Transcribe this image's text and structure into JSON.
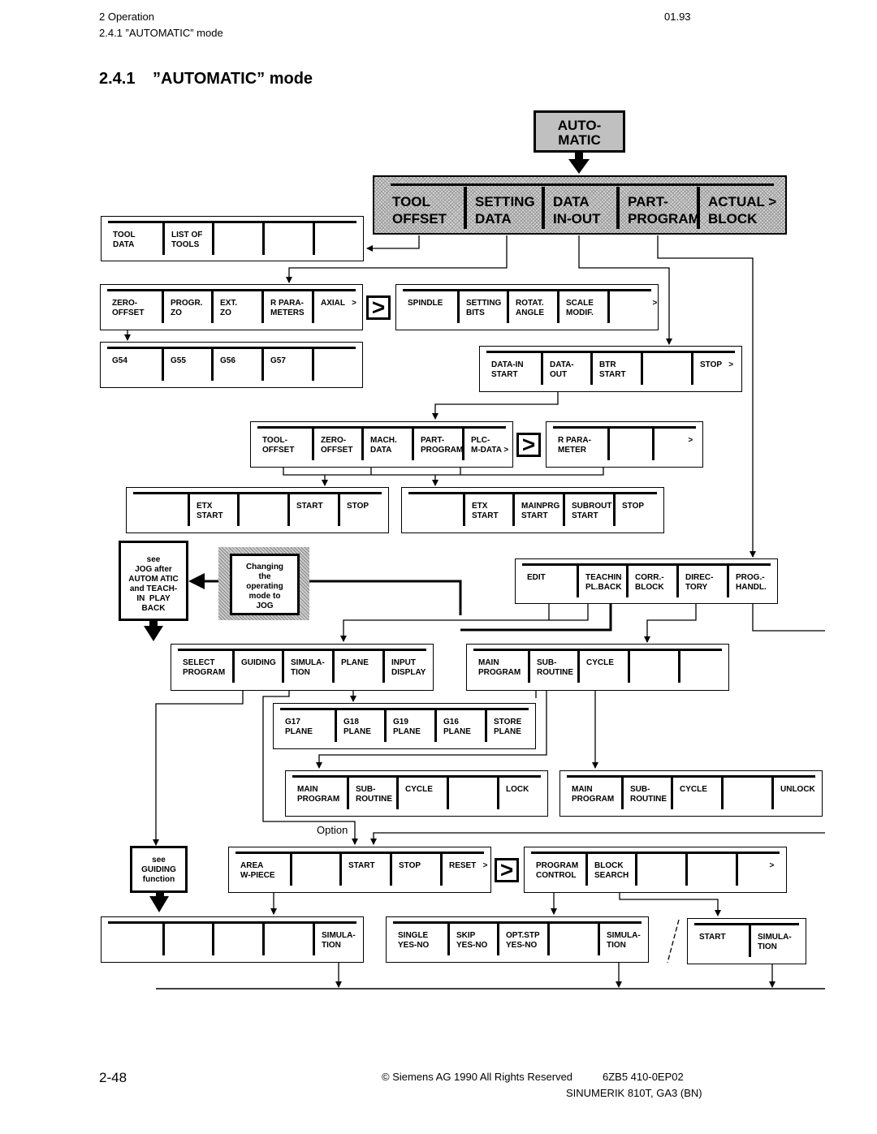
{
  "header": {
    "chapter": "2  Operation",
    "section": "2.4.1  ”AUTOMATIC” mode",
    "date": "01.93"
  },
  "title": {
    "number": "2.4.1",
    "text": "”AUTOMATIC” mode"
  },
  "mode_key": "AUTO-\nMATIC",
  "main_bar": [
    "TOOL\nOFFSET",
    "SETTING\nDATA",
    "DATA\nIN-OUT",
    "PART-\nPROGRAM",
    "ACTUAL >\nBLOCK"
  ],
  "bars": {
    "tool_offset": [
      "TOOL\nDATA",
      "LIST OF\nTOOLS",
      "",
      "",
      ""
    ],
    "setting_data_1": [
      "ZERO-\nOFFSET",
      "PROGR.\nZO",
      "EXT.\nZO",
      "R PARA-\nMETERS",
      "AXIAL   >"
    ],
    "setting_data_2": [
      "SPINDLE",
      "SETTING\nBITS",
      "ROTAT.\nANGLE",
      "SCALE\nMODIF.",
      "                >"
    ],
    "zero_offset": [
      "G54",
      "G55",
      "G56",
      "G57",
      ""
    ],
    "data_in_out": [
      "DATA-IN\nSTART",
      "DATA-\nOUT",
      "BTR\nSTART",
      "",
      "STOP   >"
    ],
    "data_out_1": [
      "TOOL-\nOFFSET",
      "ZERO-\nOFFSET",
      "MACH.\nDATA",
      "PART-\nPROGRAM",
      "PLC-\nM-DATA >"
    ],
    "data_out_2": [
      "R PARA-\nMETER",
      "",
      "            >"
    ],
    "etx_1": [
      "",
      "ETX\nSTART",
      "",
      "START",
      "STOP"
    ],
    "etx_2": [
      "",
      "ETX\nSTART",
      "MAINPRG\nSTART",
      "SUBROUT\nSTART",
      "STOP"
    ],
    "part_program": [
      "EDIT",
      "TEACHIN\nPL.BACK",
      "CORR.-\nBLOCK",
      "DIREC-\nTORY",
      "PROG.-\nHANDL."
    ],
    "edit": [
      "SELECT\nPROGRAM",
      "GUIDING",
      "SIMULA-\nTION",
      "PLANE",
      "INPUT\nDISPLAY"
    ],
    "directory": [
      "MAIN\nPROGRAM",
      "SUB-\nROUTINE",
      "CYCLE",
      "",
      ""
    ],
    "plane": [
      "G17\nPLANE",
      "G18\nPLANE",
      "G19\nPLANE",
      "G16\nPLANE",
      "STORE\nPLANE"
    ],
    "lock": [
      "MAIN\nPROGRAM",
      "SUB-\nROUTINE",
      "CYCLE",
      "",
      "LOCK"
    ],
    "unlock": [
      "MAIN\nPROGRAM",
      "SUB-\nROUTINE",
      "CYCLE",
      "",
      "UNLOCK"
    ],
    "simulation": [
      "AREA\nW-PIECE",
      "",
      "START",
      "STOP",
      "RESET   >"
    ],
    "program_control_bar": [
      "PROGRAM\nCONTROL",
      "BLOCK\nSEARCH",
      "",
      "",
      "           >"
    ],
    "sim_area": [
      "",
      "",
      "",
      "",
      "SIMULA-\nTION"
    ],
    "prog_control": [
      "SINGLE\nYES-NO",
      "SKIP\nYES-NO",
      "OPT.STP\nYES-NO",
      "",
      "SIMULA-\nTION"
    ],
    "block_search": [
      "START",
      "SIMULA-\nTION"
    ]
  },
  "next_glyph": ">",
  "notes": {
    "jog_see": "see\nJOG after\nAUTOM ATIC\nand TEACH-\nIN  PLAY\nBACK",
    "changing_mode": "Changing\nthe\noperating\nmode to\nJOG",
    "guiding_see": "see\nGUIDING\nfunction"
  },
  "option_label": "Option",
  "footer": {
    "page": "2-48",
    "copyright": "© Siemens AG 1990 All Rights Reserved",
    "order_no": "6ZB5 410-0EP02",
    "product": "SINUMERIK 810T, GA3 (BN)"
  }
}
